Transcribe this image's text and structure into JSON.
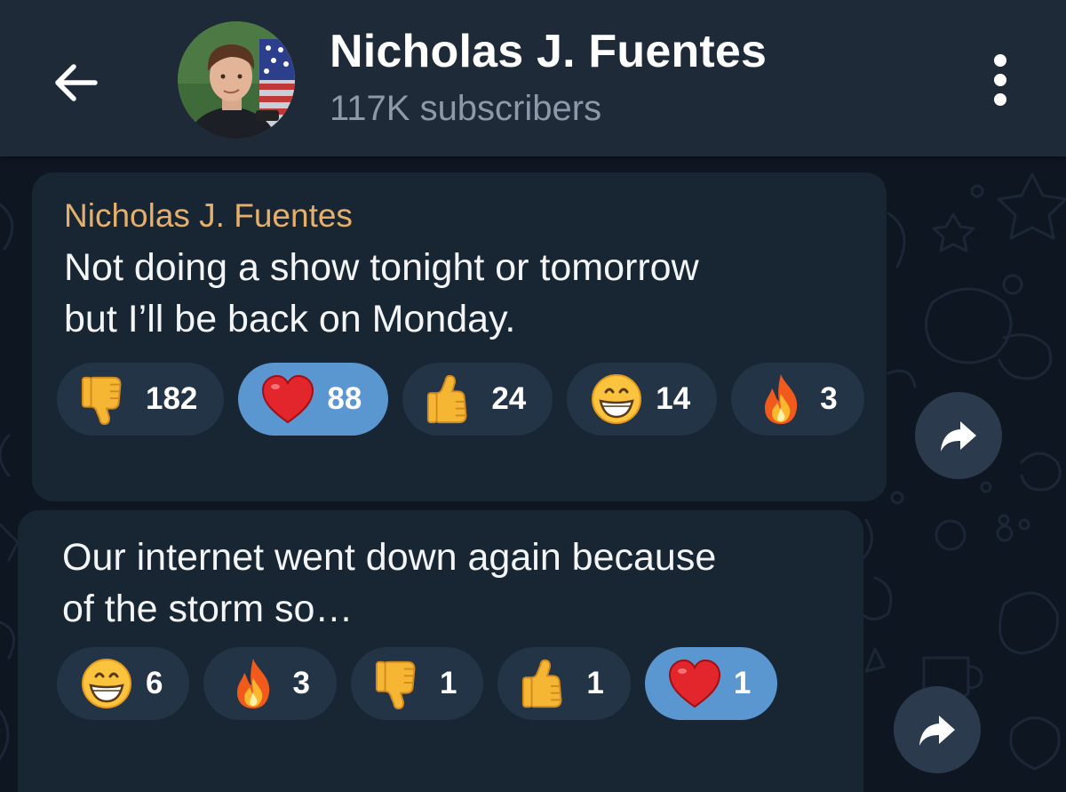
{
  "header": {
    "channel_name": "Nicholas J. Fuentes",
    "subscribers": "117K subscribers"
  },
  "messages": [
    {
      "sender": "Nicholas J. Fuentes",
      "text_line_1": "Not doing a show tonight or tomorrow",
      "text_line_2": "but I’ll be back on Monday.",
      "reactions": [
        {
          "emoji": "thumbs-down",
          "count": "182",
          "selected": false
        },
        {
          "emoji": "red-heart",
          "count": "88",
          "selected": true
        },
        {
          "emoji": "thumbs-up",
          "count": "24",
          "selected": false
        },
        {
          "emoji": "grinning-face",
          "count": "14",
          "selected": false
        },
        {
          "emoji": "fire",
          "count": "3",
          "selected": false
        }
      ]
    },
    {
      "text_line_1": "Our internet went down again because",
      "text_line_2": "of the storm so…",
      "reactions": [
        {
          "emoji": "grinning-face",
          "count": "6",
          "selected": false
        },
        {
          "emoji": "fire",
          "count": "3",
          "selected": false
        },
        {
          "emoji": "thumbs-down",
          "count": "1",
          "selected": false
        },
        {
          "emoji": "thumbs-up",
          "count": "1",
          "selected": false
        },
        {
          "emoji": "red-heart",
          "count": "1",
          "selected": true
        }
      ]
    }
  ],
  "colors": {
    "header_bg": "#1e2a38",
    "bubble_bg": "#182533",
    "sender_name": "#e6b06b",
    "selected_reaction": "#5a96cf",
    "reaction_bg": "#243447",
    "subtitle": "#8b99a8"
  },
  "icons": [
    "back-arrow-icon",
    "more-vertical-icon",
    "share-arrow-icon"
  ]
}
